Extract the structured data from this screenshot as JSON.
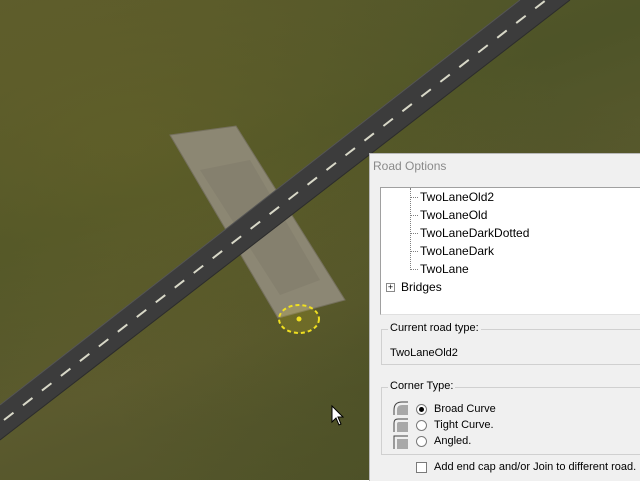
{
  "panel": {
    "title": "Road Options",
    "tree": {
      "children": [
        "TwoLaneOld2",
        "TwoLaneOld",
        "TwoLaneDarkDotted",
        "TwoLaneDark",
        "TwoLane"
      ],
      "collapsed_item": "Bridges"
    },
    "current_road_type": {
      "label": "Current road type:",
      "value": "TwoLaneOld2"
    },
    "corner_type": {
      "label": "Corner Type:",
      "options": [
        {
          "label": "Broad Curve",
          "selected": true
        },
        {
          "label": "Tight Curve.",
          "selected": false
        },
        {
          "label": "Angled.",
          "selected": false
        }
      ]
    },
    "end_cap_checkbox": {
      "label": "Add end cap and/or Join to different road.",
      "checked": false
    }
  },
  "colors": {
    "grass": "#55552a",
    "road": "#3c3c3c",
    "lane_marking": "#d8d8c8",
    "dirt_patch": "#8f8a78",
    "selection_ring": "#f0e020"
  }
}
